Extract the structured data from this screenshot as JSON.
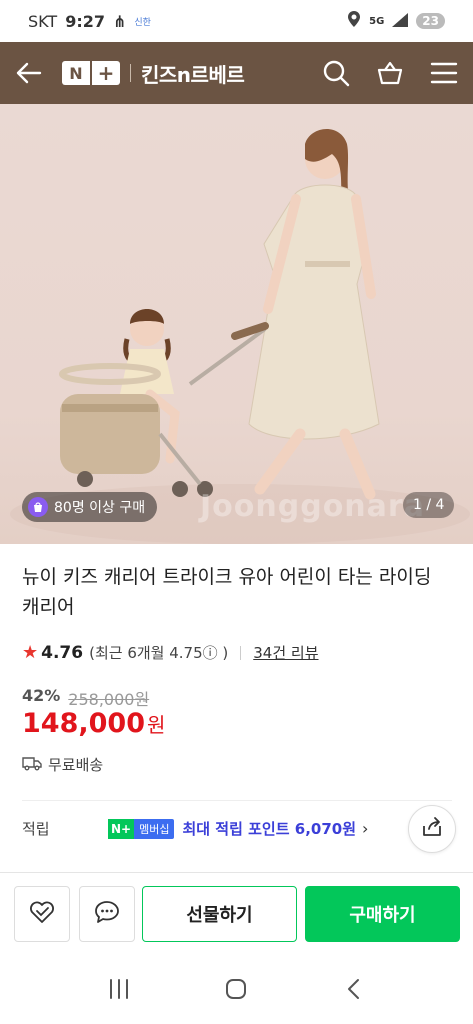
{
  "status_bar": {
    "carrier": "SKT",
    "time": "9:27",
    "chip": "신한",
    "network": "5G",
    "battery": "23"
  },
  "header": {
    "logo_n": "N",
    "logo_plus": "+",
    "store_name": "킨즈n르베르"
  },
  "hero": {
    "buyers_badge": "80명 이상 구매",
    "pager": "1 / 4",
    "watermark": "Joonggonara"
  },
  "product": {
    "title": "뉴이 키즈 캐리어 트라이크 유아 어린이 타는 라이딩 캐리어",
    "rating": "4.76",
    "rating_recent": "(최근 6개월 4.75ⓘ )",
    "reviews": "34건 리뷰",
    "discount": "42%",
    "original_price": "258,000원",
    "price": "148,000",
    "currency": "원",
    "shipping": "무료배송"
  },
  "points": {
    "label": "적립",
    "badge_g": "N+",
    "badge_m": "멤버십",
    "text": "최대 적립 포인트 6,070원",
    "chevron": "›"
  },
  "bottom": {
    "gift_label": "선물하기",
    "buy_label": "구매하기"
  },
  "colors": {
    "header_bg": "#6b5443",
    "accent_green": "#03c75a",
    "price_red": "#e1151c",
    "points_blue": "#3b3fd8"
  }
}
